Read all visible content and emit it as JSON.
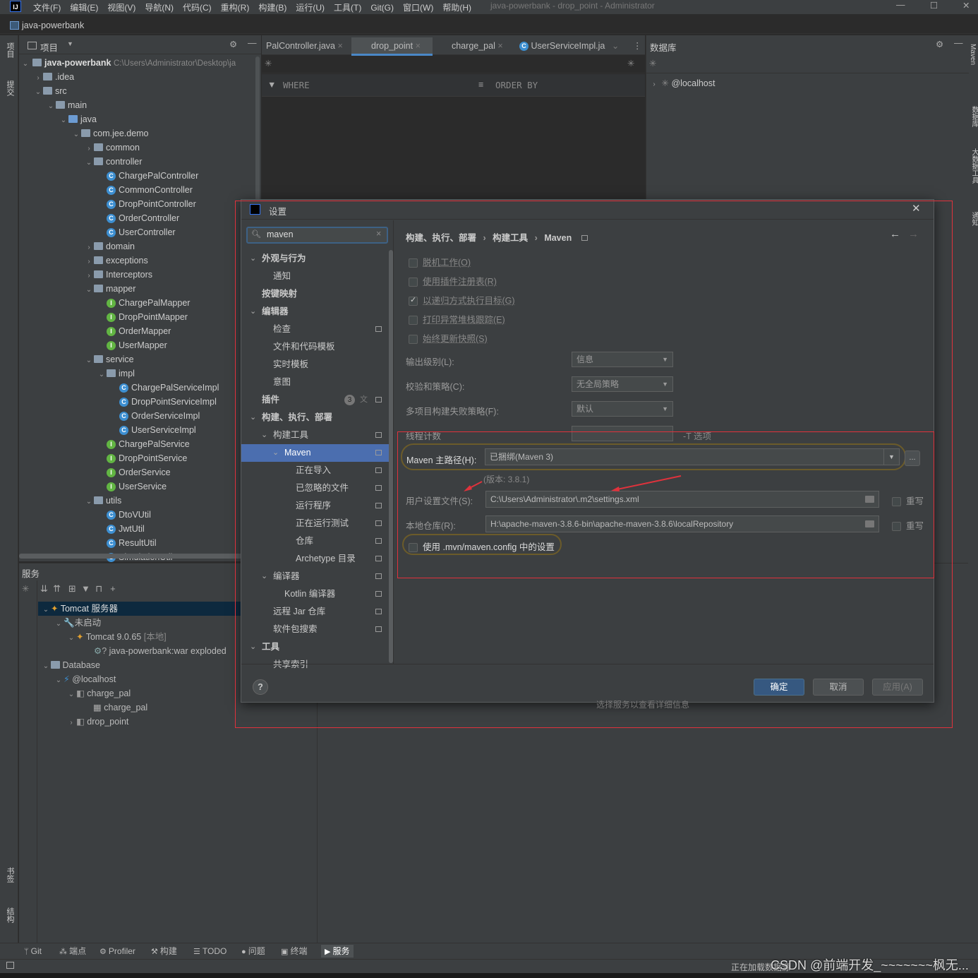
{
  "menubar": {
    "logo": "IJ",
    "items": [
      "文件(F)",
      "编辑(E)",
      "视图(V)",
      "导航(N)",
      "代码(C)",
      "重构(R)",
      "构建(B)",
      "运行(U)",
      "工具(T)",
      "Git(G)",
      "窗口(W)",
      "帮助(H)"
    ],
    "window_title": "java-powerbank - drop_point - Administrator"
  },
  "breadcrumb": "java-powerbank",
  "project_panel": {
    "title": "项目",
    "root_name": "java-powerbank",
    "root_path": "C:\\Users\\Administrator\\Desktop\\ja",
    "tree": [
      {
        "label": ".idea",
        "icon": "folder"
      },
      {
        "label": "src",
        "icon": "folder"
      },
      {
        "label": "main",
        "icon": "folder"
      },
      {
        "label": "java",
        "icon": "folder-blue"
      },
      {
        "label": "com.jee.demo",
        "icon": "package"
      },
      {
        "label": "common",
        "icon": "package"
      },
      {
        "label": "controller",
        "icon": "package"
      },
      {
        "label": "ChargePalController",
        "icon": "class"
      },
      {
        "label": "CommonController",
        "icon": "class"
      },
      {
        "label": "DropPointController",
        "icon": "class"
      },
      {
        "label": "OrderController",
        "icon": "class"
      },
      {
        "label": "UserController",
        "icon": "class"
      },
      {
        "label": "domain",
        "icon": "package"
      },
      {
        "label": "exceptions",
        "icon": "package"
      },
      {
        "label": "Interceptors",
        "icon": "package"
      },
      {
        "label": "mapper",
        "icon": "package"
      },
      {
        "label": "ChargePalMapper",
        "icon": "interface"
      },
      {
        "label": "DropPointMapper",
        "icon": "interface"
      },
      {
        "label": "OrderMapper",
        "icon": "interface"
      },
      {
        "label": "UserMapper",
        "icon": "interface"
      },
      {
        "label": "service",
        "icon": "package"
      },
      {
        "label": "impl",
        "icon": "package"
      },
      {
        "label": "ChargePalServiceImpl",
        "icon": "class"
      },
      {
        "label": "DropPointServiceImpl",
        "icon": "class"
      },
      {
        "label": "OrderServiceImpl",
        "icon": "class"
      },
      {
        "label": "UserServiceImpl",
        "icon": "class"
      },
      {
        "label": "ChargePalService",
        "icon": "interface"
      },
      {
        "label": "DropPointService",
        "icon": "interface"
      },
      {
        "label": "OrderService",
        "icon": "interface"
      },
      {
        "label": "UserService",
        "icon": "interface"
      },
      {
        "label": "utils",
        "icon": "package"
      },
      {
        "label": "DtoVUtil",
        "icon": "class"
      },
      {
        "label": "JwtUtil",
        "icon": "class"
      },
      {
        "label": "ResultUtil",
        "icon": "class"
      },
      {
        "label": "SimulationUtil",
        "icon": "class"
      }
    ]
  },
  "editor_tabs": [
    "PalController.java",
    "drop_point",
    "charge_pal",
    "UserServiceImpl.ja"
  ],
  "editor_filters": {
    "where": "WHERE",
    "order_by": "ORDER BY"
  },
  "database_panel": {
    "title": "数据库",
    "root": "@localhost"
  },
  "services_panel": {
    "title": "服务",
    "items": [
      "Tomcat 服务器",
      "未启动",
      "Tomcat 9.0.65",
      "java-powerbank:war exploded",
      "Database",
      "@localhost",
      "charge_pal",
      "charge_pal",
      "drop_point"
    ],
    "tomcat_suffix": "[本地]"
  },
  "left_strip": [
    "项目",
    "提交",
    "书签",
    "结构"
  ],
  "right_strip": [
    "Maven",
    "数据库",
    "大数据工具",
    "通知"
  ],
  "dialog": {
    "title": "设置",
    "search_value": "maven",
    "nav": [
      "外观与行为",
      "通知",
      "按键映射",
      "编辑器",
      "检查",
      "文件和代码模板",
      "实时模板",
      "意图",
      "插件",
      "构建、执行、部署",
      "构建工具",
      "Maven",
      "正在导入",
      "已忽略的文件",
      "运行程序",
      "正在运行测试",
      "仓库",
      "Archetype 目录",
      "编译器",
      "Kotlin 编译器",
      "远程 Jar 仓库",
      "软件包搜索",
      "工具",
      "共享索引"
    ],
    "plugin_badge": "3",
    "breadcrumb": [
      "构建、执行、部署",
      "构建工具",
      "Maven"
    ],
    "checkboxes": [
      {
        "label": "脱机工作(O)",
        "checked": false
      },
      {
        "label": "使用插件注册表(R)",
        "checked": false
      },
      {
        "label": "以递归方式执行目标(G)",
        "checked": true
      },
      {
        "label": "打印异常堆栈跟踪(E)",
        "checked": false
      },
      {
        "label": "始终更新快照(S)",
        "checked": false
      }
    ],
    "output_level_label": "输出级别(L):",
    "output_level_value": "信息",
    "checksum_label": "校验和策略(C):",
    "checksum_value": "无全局策略",
    "fail_policy_label": "多项目构建失败策略(F):",
    "fail_policy_value": "默认",
    "thread_label": "线程计数",
    "thread_hint": "-T 选项",
    "maven_home_label": "Maven 主路径(H):",
    "maven_home_value": "已捆绑(Maven 3)",
    "version_text": "(版本: 3.8.1)",
    "user_settings_label": "用户设置文件(S):",
    "user_settings_value": "C:\\Users\\Administrator\\.m2\\settings.xml",
    "local_repo_label": "本地仓库(R):",
    "local_repo_value": "H:\\apache-maven-3.8.6-bin\\apache-maven-3.8.6\\localRepository",
    "override_label": "重写",
    "mvn_config_label": "使用 .mvn/maven.config 中的设置",
    "ok": "确定",
    "cancel": "取消",
    "apply": "应用(A)",
    "help": "?",
    "under_text": "选择服务以查看详细信息"
  },
  "bottom_tabs": [
    "Git",
    "端点",
    "Profiler",
    "构建",
    "TODO",
    "问题",
    "终端",
    "服务"
  ],
  "status_text": "正在加载数据源",
  "watermark": "CSDN @前端开发_~~~~~~~枫无..."
}
